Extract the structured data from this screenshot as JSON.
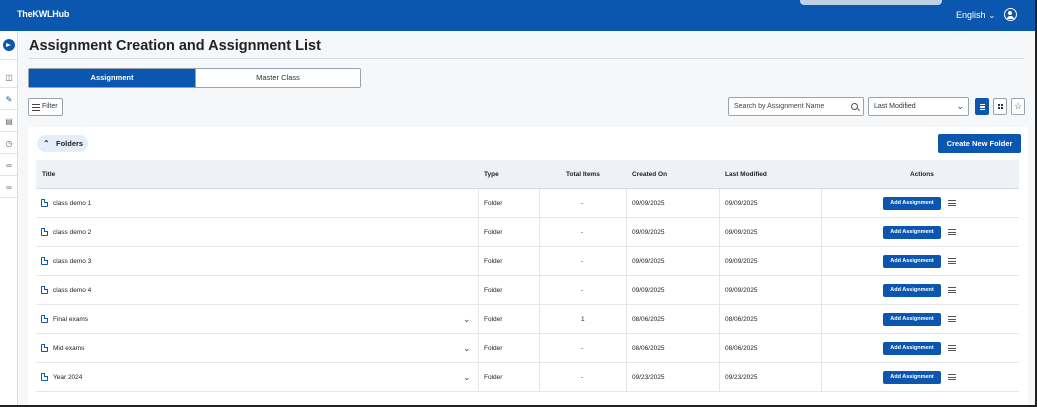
{
  "app": {
    "logo": "TheKWLHub",
    "language": "English"
  },
  "page": {
    "title": "Assignment Creation and Assignment List"
  },
  "tabs": [
    {
      "label": "Assignment",
      "active": true
    },
    {
      "label": "Master Class",
      "active": false
    }
  ],
  "toolbar": {
    "filter_label": "Filter",
    "search_placeholder": "Search by Assignment Name",
    "sort_value": "Last Modified"
  },
  "folders": {
    "label": "Folders",
    "create_label": "Create New Folder"
  },
  "table": {
    "columns": [
      "Title",
      "Type",
      "Total Items",
      "Created On",
      "Last Modified",
      "Actions"
    ],
    "action_label": "Add Assignment",
    "rows": [
      {
        "title": "class demo 1",
        "type": "Folder",
        "total": "-",
        "created": "09/09/2025",
        "modified": "09/09/2025",
        "expandable": false
      },
      {
        "title": "class demo 2",
        "type": "Folder",
        "total": "-",
        "created": "09/09/2025",
        "modified": "09/09/2025",
        "expandable": false
      },
      {
        "title": "class demo 3",
        "type": "Folder",
        "total": "-",
        "created": "09/09/2025",
        "modified": "09/09/2025",
        "expandable": false
      },
      {
        "title": "class demo 4",
        "type": "Folder",
        "total": "-",
        "created": "09/09/2025",
        "modified": "09/09/2025",
        "expandable": false
      },
      {
        "title": "Final exams",
        "type": "Folder",
        "total": "1",
        "created": "08/06/2025",
        "modified": "08/06/2025",
        "expandable": true
      },
      {
        "title": "Mid exams",
        "type": "Folder",
        "total": "-",
        "created": "08/06/2025",
        "modified": "08/06/2025",
        "expandable": true
      },
      {
        "title": "Year 2024",
        "type": "Folder",
        "total": "-",
        "created": "09/23/2025",
        "modified": "09/23/2025",
        "expandable": true
      }
    ]
  },
  "colors": {
    "brand": "#0b57b0",
    "header_bg": "#eef1f5",
    "page_bg": "#f6f7f9"
  },
  "icons": {
    "sidebar": [
      "sidebar-toggle-icon",
      "book-icon",
      "assignment-icon",
      "course-icon",
      "clock-icon",
      "link-icon",
      "link-icon"
    ],
    "row": "document-icon",
    "row_menu": "menu-icon"
  }
}
